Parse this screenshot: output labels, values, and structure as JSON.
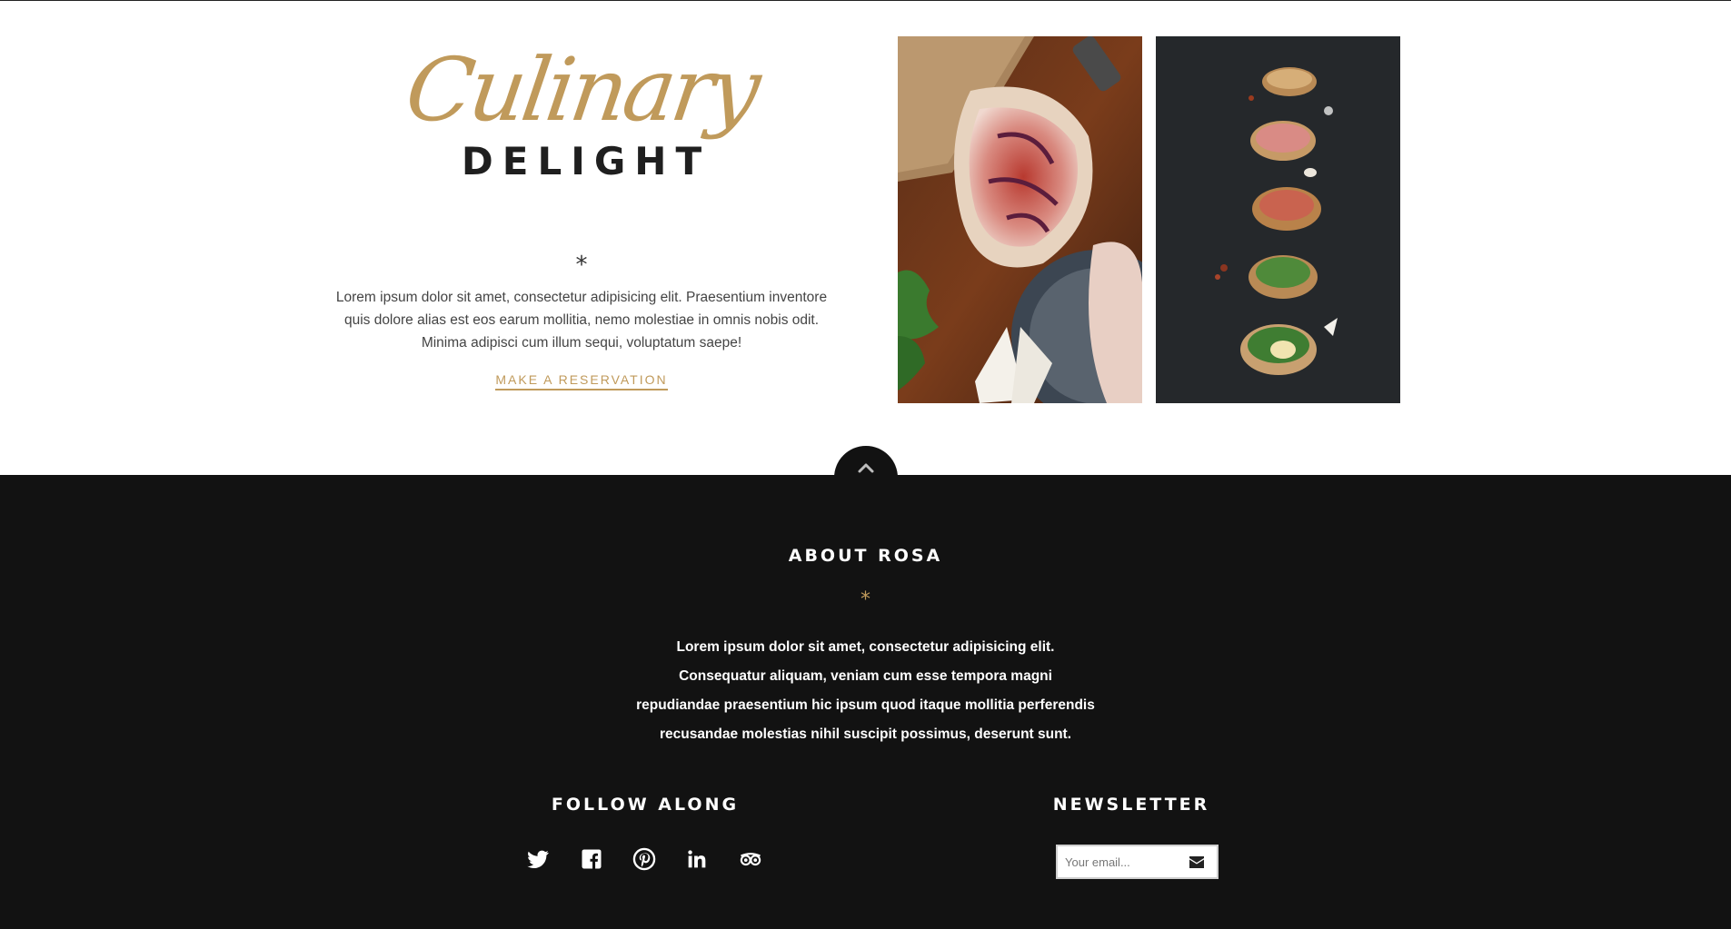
{
  "intro": {
    "logo_script": "Culinary",
    "logo_block": "DELIGHT",
    "divider": "*",
    "body": "Lorem ipsum dolor sit amet, consectetur adipisicing elit. Praesentium inventore quis dolore alias est eos earum mollitia, nemo molestiae in omnis nobis odit. Minima adipisci cum illum sequi, voluptatum saepe!",
    "cta_label": "MAKE A RESERVATION"
  },
  "colors": {
    "accent": "#c09a5b",
    "footer_bg": "#121212",
    "heading_dark": "#1f1f1f"
  },
  "back_to_top": {
    "icon": "chevron-up-icon"
  },
  "footer": {
    "about_title": "ABOUT ROSA",
    "divider": "*",
    "about_body": "Lorem ipsum dolor sit amet, consectetur adipisicing elit. Consequatur aliquam, veniam cum esse tempora magni repudiandae praesentium hic ipsum quod itaque mollitia perferendis recusandae molestias nihil suscipit possimus, deserunt sunt.",
    "follow_title": "FOLLOW ALONG",
    "socials": [
      "twitter-icon",
      "facebook-icon",
      "pinterest-icon",
      "linkedin-icon",
      "tripadvisor-icon"
    ],
    "newsletter_title": "NEWSLETTER",
    "email_placeholder": "Your email...",
    "submit_icon": "envelope-icon"
  }
}
